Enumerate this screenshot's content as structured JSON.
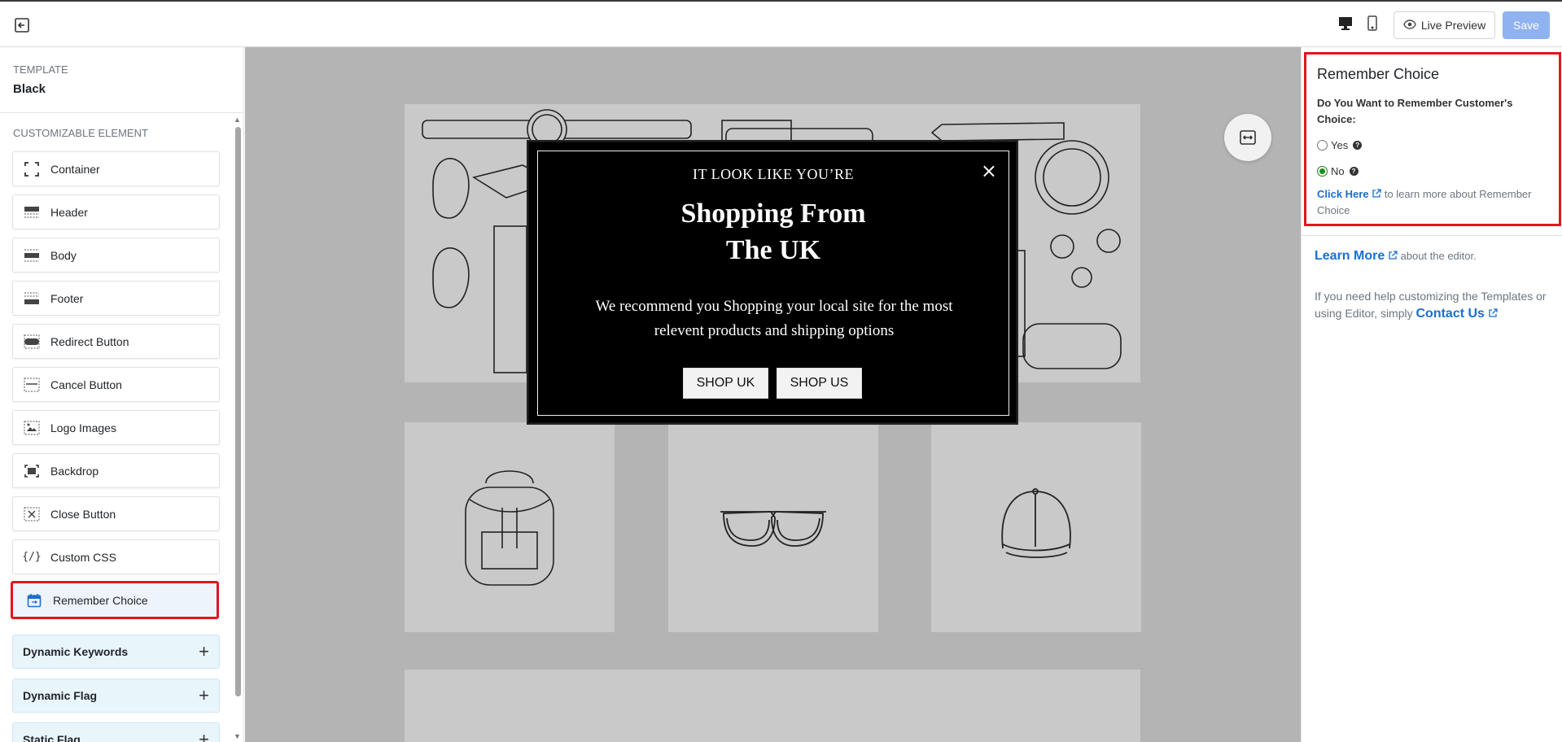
{
  "topbar": {
    "live_preview_label": "Live Preview",
    "save_label": "Save"
  },
  "sidebar": {
    "template_label": "TEMPLATE",
    "template_value": "Black",
    "customizable_label": "CUSTOMIZABLE ELEMENT",
    "items": [
      {
        "label": "Container",
        "icon": "container-icon"
      },
      {
        "label": "Header",
        "icon": "header-icon"
      },
      {
        "label": "Body",
        "icon": "body-icon"
      },
      {
        "label": "Footer",
        "icon": "footer-icon"
      },
      {
        "label": "Redirect Button",
        "icon": "redirect-button-icon"
      },
      {
        "label": "Cancel Button",
        "icon": "cancel-button-icon"
      },
      {
        "label": "Logo Images",
        "icon": "logo-images-icon"
      },
      {
        "label": "Backdrop",
        "icon": "backdrop-icon"
      },
      {
        "label": "Close Button",
        "icon": "close-button-icon"
      },
      {
        "label": "Custom CSS",
        "icon": "custom-css-icon"
      },
      {
        "label": "Remember Choice",
        "icon": "calendar-icon"
      }
    ],
    "accordions": [
      {
        "label": "Dynamic Keywords"
      },
      {
        "label": "Dynamic Flag"
      },
      {
        "label": "Static Flag"
      }
    ]
  },
  "popup": {
    "pre_title": "IT LOOK LIKE YOU’RE",
    "title_line1": "Shopping From",
    "title_line2": "The UK",
    "body_line1": "We recommend you Shopping your local site for the most",
    "body_line2": "relevent products and shipping options",
    "button_primary": "SHOP UK",
    "button_secondary": "SHOP US",
    "close_glyph": "×"
  },
  "right_panel": {
    "title": "Remember Choice",
    "question": "Do You Want to Remember Customer's Choice:",
    "options": [
      {
        "label": "Yes",
        "checked": false
      },
      {
        "label": "No",
        "checked": true
      }
    ],
    "help_link": "Click Here",
    "help_text": "to learn more about Remember Choice",
    "learn_more_link": "Learn More",
    "learn_more_text": "about the editor.",
    "contact_text": "If you need help customizing the Templates or using Editor, simply",
    "contact_link": "Contact Us"
  },
  "colors": {
    "accent": "#1a6fd0",
    "highlight_border": "#e4151f",
    "save_button": "#8fb2f0",
    "canvas_bg": "#b4b4b4"
  }
}
